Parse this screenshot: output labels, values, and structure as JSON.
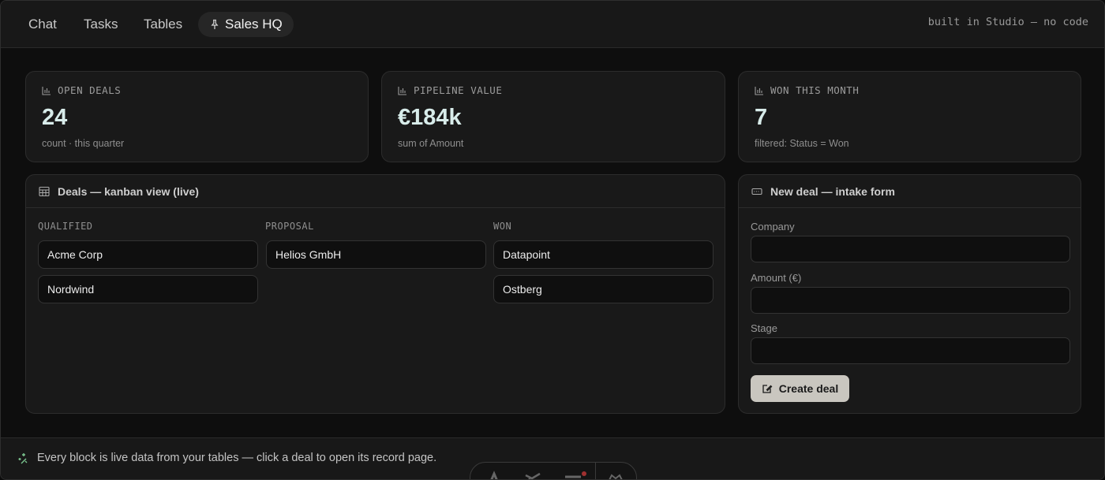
{
  "nav": {
    "tabs": [
      {
        "label": "Chat"
      },
      {
        "label": "Tasks"
      },
      {
        "label": "Tables"
      },
      {
        "label": "Sales HQ",
        "active": true,
        "icon": "pin-icon"
      }
    ],
    "tagline": "built in Studio — no code"
  },
  "stats": [
    {
      "label": "OPEN DEALS",
      "value": "24",
      "sub": "count · this quarter",
      "icon": "bar-chart-icon"
    },
    {
      "label": "PIPELINE VALUE",
      "value": "€184k",
      "sub": "sum of Amount",
      "icon": "bar-chart-icon"
    },
    {
      "label": "WON THIS MONTH",
      "value": "7",
      "sub": "filtered: Status = Won",
      "icon": "bar-chart-icon"
    }
  ],
  "kanban": {
    "title": "Deals — kanban view (live)",
    "icon": "table-icon",
    "columns": [
      {
        "title": "QUALIFIED",
        "deals": [
          "Acme Corp",
          "Nordwind"
        ]
      },
      {
        "title": "PROPOSAL",
        "deals": [
          "Helios GmbH"
        ]
      },
      {
        "title": "WON",
        "deals": [
          "Datapoint",
          "Ostberg"
        ]
      }
    ]
  },
  "form": {
    "title": "New deal — intake form",
    "icon": "form-icon",
    "fields": [
      {
        "label": "Company",
        "value": ""
      },
      {
        "label": "Amount (€)",
        "value": ""
      },
      {
        "label": "Stage",
        "value": ""
      }
    ],
    "submit_label": "Create deal",
    "submit_icon": "edit-icon"
  },
  "footer": {
    "text": "Every block is live data from your tables — click a deal to open its record page.",
    "icon": "sparkle-icon"
  },
  "colors": {
    "accent_value": "#d8ecea",
    "button_bg": "#c9c6bf",
    "sparkle": "#7bc58f"
  }
}
